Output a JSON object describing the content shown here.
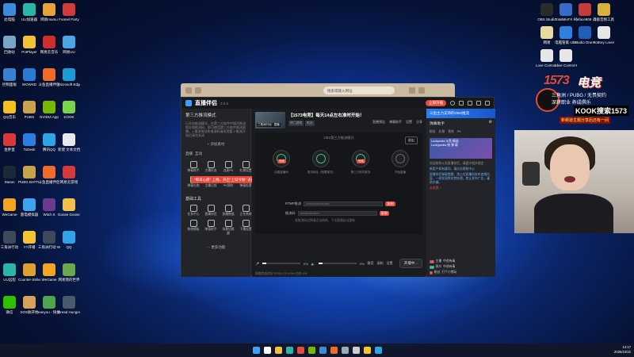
{
  "desktop_left": [
    {
      "label": "此电脑",
      "color": "#3d8bd8"
    },
    {
      "label": "UU加速器",
      "color": "#2bb5a8"
    },
    {
      "label": "网易mumu",
      "color": "#e8a23a"
    },
    {
      "label": "Funnel Party",
      "color": "#d23b3b"
    },
    {
      "label": "回收站",
      "color": "#7aa4c6"
    },
    {
      "label": "PotPlayer",
      "color": "#f2c230"
    },
    {
      "label": "网易云音乐",
      "color": "#d02d2d"
    },
    {
      "label": "网易UU",
      "color": "#4aa7e6"
    },
    {
      "label": "控制面板",
      "color": "#3a82d0"
    },
    {
      "label": "WOWSD",
      "color": "#2a7ad6"
    },
    {
      "label": "斗鱼直播伴侣",
      "color": "#f06a2a"
    },
    {
      "label": "Microsoft Edge",
      "color": "#1e9bd7"
    },
    {
      "label": "QQ音乐",
      "color": "#f4c01d"
    },
    {
      "label": "PUBG",
      "color": "#c8a349"
    },
    {
      "label": "NVIDIA App",
      "color": "#76b900"
    },
    {
      "label": "KOOK",
      "color": "#7bd44c"
    },
    {
      "label": "金胖蛋",
      "color": "#d83a3a"
    },
    {
      "label": "ToDesk",
      "color": "#2b7de0"
    },
    {
      "label": "腾讯QQ",
      "color": "#2fa4e7"
    },
    {
      "label": "新建 文本文档",
      "color": "#e9e9e9"
    },
    {
      "label": "Steam",
      "color": "#1b2838"
    },
    {
      "label": "PUBG BATTLEGR...",
      "color": "#c8a349"
    },
    {
      "label": "斗鱼直播伴侣",
      "color": "#f06a2a"
    },
    {
      "label": "网易云游戏",
      "color": "#d53a3a"
    },
    {
      "label": "WeGame",
      "color": "#f2a423"
    },
    {
      "label": "雷电模拟器",
      "color": "#3da3ee"
    },
    {
      "label": "Witch It",
      "color": "#6b3b8c"
    },
    {
      "label": "Goose Goose Duck",
      "color": "#f1c14b"
    },
    {
      "label": "三角洲行动",
      "color": "#3e4a5a"
    },
    {
      "label": "YY开播",
      "color": "#f4c430"
    },
    {
      "label": "三角洲行动 WeGame版",
      "color": "#3e4a5a"
    },
    {
      "label": "QQ",
      "color": "#2fa4e7"
    },
    {
      "label": "UU远程",
      "color": "#2bb5a8"
    },
    {
      "label": "Counter-Strike 2",
      "color": "#e0a030"
    },
    {
      "label": "WeGame",
      "color": "#f2a423"
    },
    {
      "label": "网易我的世界",
      "color": "#6aa84f"
    },
    {
      "label": "微信",
      "color": "#2dc100"
    },
    {
      "label": "SOS肤开始",
      "color": "#d9a05b"
    },
    {
      "label": "eanyou - 快捷方式",
      "color": "#4ea54e"
    },
    {
      "label": "Dread Hunger",
      "color": "#4a5a6a"
    }
  ],
  "desktop_right": [
    {
      "label": "OBS Studio",
      "color": "#2b2b2b"
    },
    {
      "label": "TotalMixFX - 快捷方式",
      "color": "#3a6ac8"
    },
    {
      "label": "fireface808 - 快捷方式",
      "color": "#c53a3a"
    },
    {
      "label": "高级音频工具 - 快捷方式",
      "color": "#d8b040"
    },
    {
      "label": "网易",
      "color": "#e9d9a0"
    },
    {
      "label": "电脑管家-Ube",
      "color": "#2e7fe0"
    },
    {
      "label": "Studio One 7",
      "color": "#1f5fb8"
    },
    {
      "label": "HotKey Lover Control...",
      "color": "#e6e6e6"
    },
    {
      "label": "Love Control-快...",
      "color": "#e6e6e6"
    },
    {
      "label": "Love Control-R...",
      "color": "#e6e6e6"
    }
  ],
  "browser": {
    "address": "搜索或输入网址"
  },
  "app": {
    "title": "直播伴侣",
    "version": "3.5.6",
    "live_label": "立即开播",
    "mode_title": "第三方推流模式",
    "notice": "已开启推流模式，在第三方软件中填写推流地址和推流码，即可使用第三方软件推流直播。1.推流地址和推流码请勿泄露 2.推流开始后请勿关闭",
    "add_source": "+ 添加素材",
    "section_tabs": [
      "直播",
      "互动"
    ],
    "promo_banner": "\"每日心愿\" 上线，开启\"上日今秋\"  去打每日抽奖!",
    "tools_row1": [
      "弹幕助手",
      "主播任务",
      "连麦PK",
      "礼物设置"
    ],
    "tools_row2": [
      "弹幕礼物",
      "主播日程",
      "PK预约",
      "弹幕投票"
    ],
    "section_tools": "基础工具",
    "tools_row3": [
      "任务中心",
      "直播伴侣",
      "直播数据",
      "正在装修"
    ],
    "tools_row4": [
      "装修模板",
      "弹幕助手",
      "场景切换器",
      "下播设置"
    ],
    "more_label": "··· 更多功能",
    "room": {
      "thumb_label": "三角洲行动 · 直播",
      "title": "【1573电竞】每天14点左右准时开始！",
      "tags": [
        "热门游戏",
        "射击"
      ],
      "actions": [
        "直播预告",
        "弹幕助手",
        "设置",
        "分享"
      ]
    },
    "canvas_caption": "OBS第三方推流模式",
    "exit_label": "退出",
    "steps": [
      "创建直播间",
      "推流地址（配置推流）",
      "第三方软件推流",
      "开始直播"
    ],
    "step_tag": "完成",
    "rtmp_label": "RTMP推流",
    "key_label": "推流码",
    "rtmp_value": "••••••••••••••••••••••••",
    "key_value": "••••••••••••••••••••",
    "copy_label": "复制",
    "form_note": "若推流码过期请点击刷新，下次直播自动更新",
    "mic_label": "麦克风",
    "speaker_label": "扬声器",
    "mic_pct": "0%",
    "speaker_pct": "0%",
    "bottom_icons": [
      "静音",
      "录制",
      "设置"
    ],
    "start_label": "开播中...",
    "status": "网络状态良好  FPS:0  CPU:0%  内存:0%",
    "right": {
      "banner": "斗鱼主力支持的OBS推流",
      "head_title": "弹幕助手",
      "tabs": [
        "粉丝",
        "礼物",
        "贵宾",
        "PK"
      ],
      "video_caption": "Luckpedia 斗鱼 精选",
      "video_sub": "Luckypedia 快 弹 幕",
      "texts": [
        "欢迎来到斗鱼直播伴侣，请遵守相关规定",
        "新用户如有疑问，请点击帮助中心",
        "直播伴侣弹幕提醒：禁止在直播间发布违规内容，一经发现将封禁处理。禁止发布广告，谨防诈骗。",
        "去查看 >"
      ],
      "chat": [
        {
          "lv": "18",
          "name": "主播",
          "msg": "中途有毒"
        },
        {
          "lv": "14",
          "name": "观众",
          "msg": "中途有毒"
        },
        {
          "lv": "9",
          "name": "粉丝",
          "msg": "打个小熊玩"
        }
      ]
    }
  },
  "sponsor": {
    "num": "1573",
    "brand": "电竞",
    "line1": "三角洲 / PUBG / 无畏契约",
    "line2": "深耕职业  养成俱乐",
    "kook": "KOOK搜索1573",
    "line3": "新频道主题分享后还有一间"
  },
  "tray": {
    "time": "14:17",
    "date": "2025/10/22"
  },
  "taskbar_colors": [
    "#3ea0f7",
    "#ffffff",
    "#f0c23a",
    "#2bb5a8",
    "#e34b3d",
    "#76b900",
    "#3d8bd8",
    "#f06a2a",
    "#9ab",
    "#ccc",
    "#f4c430",
    "#2fa4e7"
  ]
}
